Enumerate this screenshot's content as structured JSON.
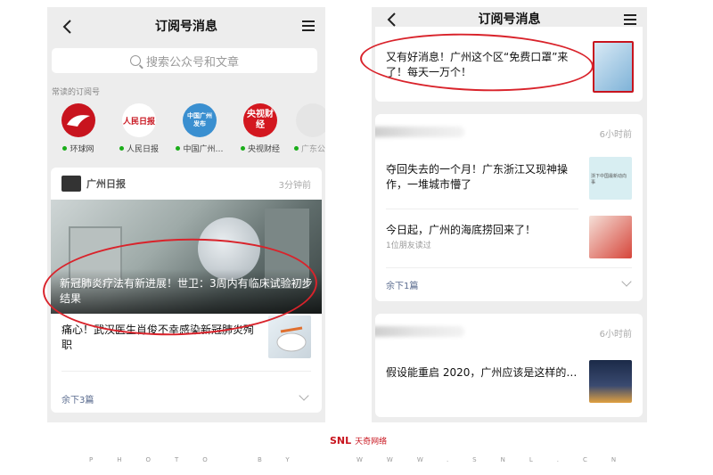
{
  "left": {
    "title": "订阅号消息",
    "search_placeholder": "搜索公众号和文章",
    "frequent_label": "常读的订阅号",
    "accounts": [
      {
        "name": "环球网",
        "logo_text": "",
        "color": "#c8141e"
      },
      {
        "name": "人民日报",
        "logo_text": "人民日报",
        "color": "#fff"
      },
      {
        "name": "中国广州…",
        "logo_text": "中国广州发布",
        "color": "#3a8fd0"
      },
      {
        "name": "央视财经",
        "logo_text": "央视财经",
        "color": "#d3171f"
      },
      {
        "name": "广东公",
        "logo_text": "",
        "color": "#eee"
      }
    ],
    "feed": {
      "source": "广州日报",
      "time": "3分钟前",
      "headline": "新冠肺炎疗法有新进展！世卫：3周内有临床试验初步结果",
      "item": "痛心！武汉医生肖俊不幸感染新冠肺炎殉职",
      "more": "余下3篇"
    }
  },
  "right": {
    "title": "订阅号消息",
    "top_item": "又有好消息！广州这个区“免费口罩”来了！每天一万个！",
    "card1": {
      "time": "6小时前",
      "item1": "夺回失去的一个月！广东浙江又现神操作，一堆城市懵了",
      "item2": "今日起，广州的海底捞回来了！",
      "item2_meta": "1位朋友读过",
      "more": "余下1篇",
      "thumb1_text": "浙下中国最新动向事"
    },
    "card2": {
      "time": "6小时前",
      "item": "假设能重启 2020，广州应该是这样的…"
    }
  },
  "footer": {
    "brand": "SNL",
    "brand_sub": "天奇网络",
    "photo": "PHOTO BY",
    "web": "WWW.SNL.CN"
  },
  "colors": {
    "accent_red": "#d9232b",
    "link_blue": "#5b6c8f",
    "online_green": "#1aad19"
  }
}
